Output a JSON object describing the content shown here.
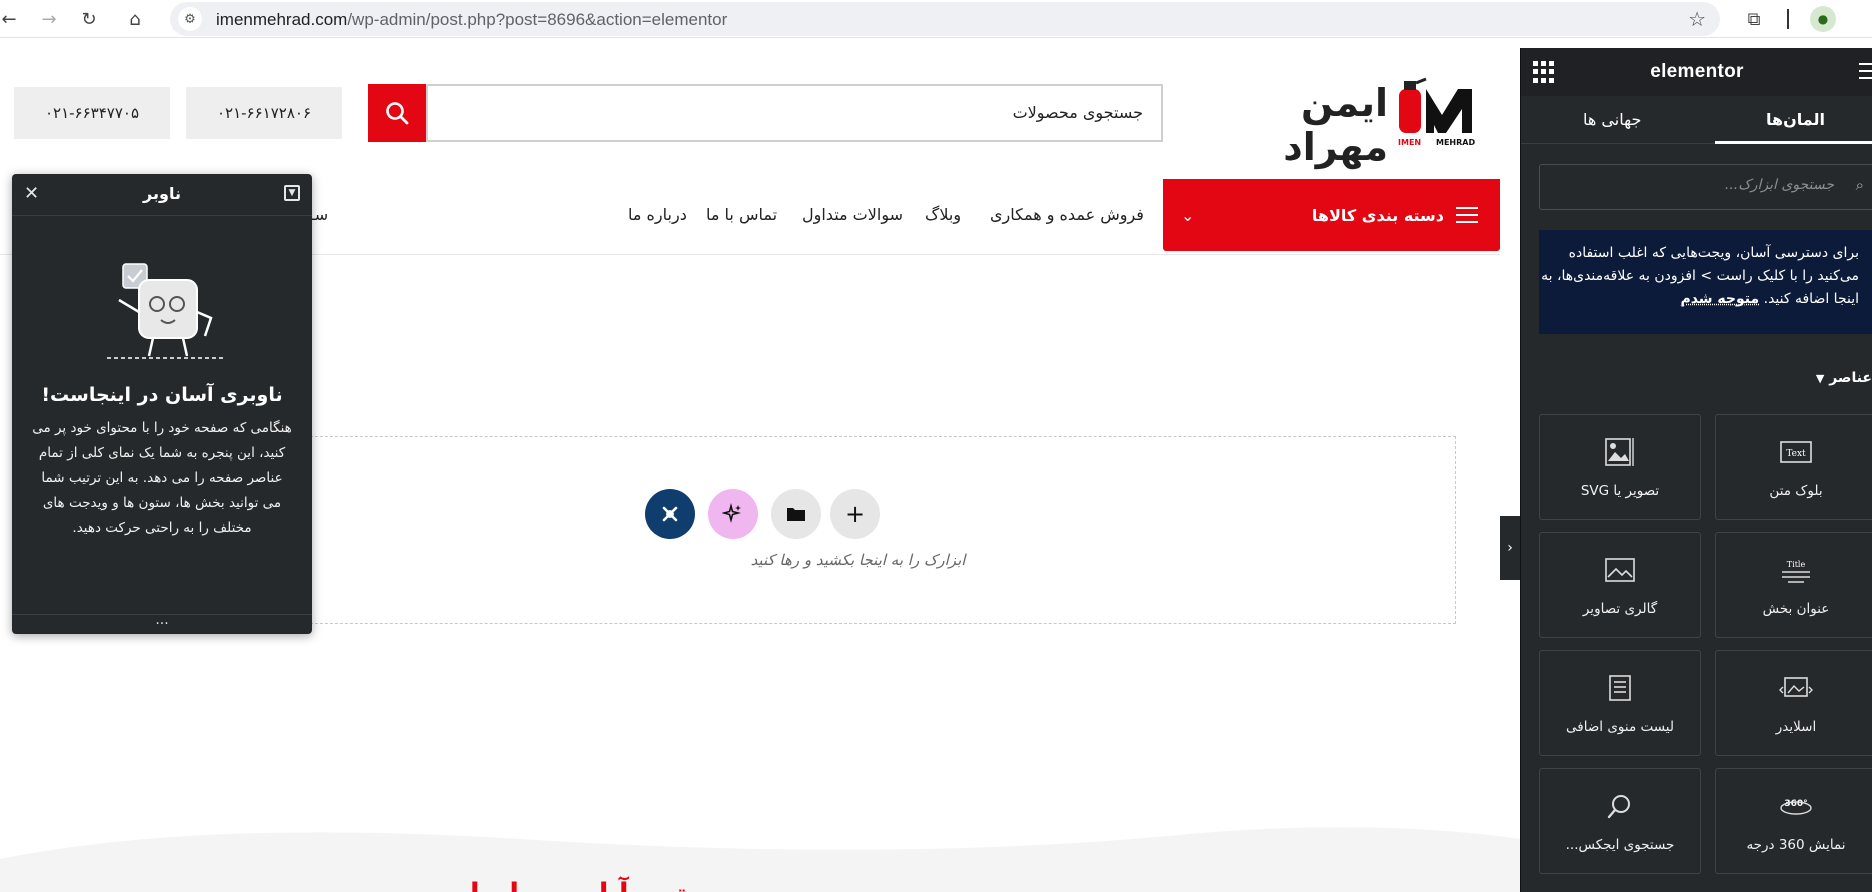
{
  "browser": {
    "back_icon": "back-arrow-icon",
    "forward_icon": "forward-arrow-icon",
    "reload_icon": "reload-icon",
    "home_icon": "home-icon",
    "url_host": "imenmehrad.com",
    "url_path": "/wp-admin/post.php?post=8696&action=elementor"
  },
  "site": {
    "phones": [
      "۰۲۱-۶۶۳۴۷۷۰۵",
      "۰۲۱-۶۶۱۷۲۸۰۶"
    ],
    "search_placeholder": "جستجوی محصولات",
    "logo_text": "ایمن مهراد",
    "logo_sub_left": "IMEN",
    "logo_sub_right": "MEHRAD",
    "category_button": "دسته بندی کالاها",
    "menu": [
      "فروش عمده و همکاری",
      "وبلاگ",
      "سوالات متداول",
      "تماس با ما",
      "درباره ما"
    ],
    "menu_overflow": "سـ",
    "drop_zone_text": "ابزارک را به اینجا بکشید و رها کنید",
    "bottom_heading": "ـتـی آـا ـ ـیـ ـاـ ـا"
  },
  "navigator": {
    "title": "ناوبر",
    "heading": "ناوبری آسان در اینجاست!",
    "body": "هنگامی که صفحه خود را با محتوای خود پر می کنید، این پنجره به شما یک نمای کلی از تمام عناصر صفحه را می دهد. به این ترتیب شما می توانید بخش ها، ستون ها و ویدجت های مختلف را به راحتی حرکت دهید.",
    "footer": "..."
  },
  "elementor": {
    "brand": "elementor",
    "tab_elements": "المان‌ها",
    "tab_global": "جهانی ها",
    "search_placeholder": "جستجوی ابزارک...",
    "notice": "برای دسترسی آسان، ویجت‌هایی که اغلب استفاده می‌کنید را با کلیک راست > افزودن به علاقه‌مندی‌ها، به اینجا اضافه کنید.",
    "notice_link": "متوجه شدم",
    "section_title": "عناصر",
    "widgets": [
      {
        "label": "بلوک متن",
        "icon": "text-editor-icon"
      },
      {
        "label": "تصویر یا SVG",
        "icon": "image-svg-icon"
      },
      {
        "label": "عنوان بخش",
        "icon": "heading-icon"
      },
      {
        "label": "گالری تصاویر",
        "icon": "gallery-icon"
      },
      {
        "label": "اسلایدر",
        "icon": "slider-icon"
      },
      {
        "label": "لیست منوی اضافی",
        "icon": "menu-list-icon"
      },
      {
        "label": "نمایش 360 درجه",
        "icon": "view-360-icon"
      },
      {
        "label": "جستجوی ایجکس...",
        "icon": "ajax-search-icon"
      }
    ]
  },
  "colors": {
    "brand_red": "#e30613",
    "panel_dark": "#26292c",
    "notice_navy": "#0c1b3a",
    "ai_pink": "#f0b6f0",
    "add_blue": "#0f3d6e"
  }
}
